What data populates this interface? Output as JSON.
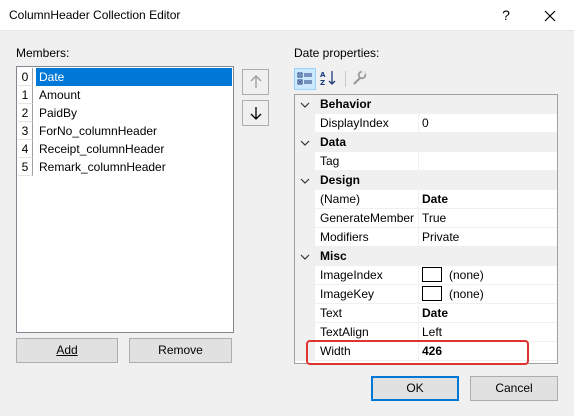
{
  "window": {
    "title": "ColumnHeader Collection Editor",
    "help_label": "?",
    "close_icon": "close-icon"
  },
  "members": {
    "label": "Members:",
    "items": [
      {
        "index": "0",
        "name": "Date",
        "selected": true
      },
      {
        "index": "1",
        "name": "Amount"
      },
      {
        "index": "2",
        "name": "PaidBy"
      },
      {
        "index": "3",
        "name": "ForNo_columnHeader"
      },
      {
        "index": "4",
        "name": "Receipt_columnHeader"
      },
      {
        "index": "5",
        "name": "Remark_columnHeader"
      }
    ],
    "move_up_icon": "arrow-up-icon",
    "move_down_icon": "arrow-down-icon"
  },
  "buttons": {
    "add": "Add",
    "remove": "Remove",
    "ok": "OK",
    "cancel": "Cancel"
  },
  "properties": {
    "label": "Date properties:",
    "toolbar": {
      "categorized_icon": "categorized-icon",
      "alphabetical_icon": "alphabetical-sort-icon",
      "property_pages_icon": "wrench-icon"
    },
    "categories": [
      {
        "name": "Behavior",
        "rows": [
          {
            "name": "DisplayIndex",
            "value": "0"
          }
        ]
      },
      {
        "name": "Data",
        "rows": [
          {
            "name": "Tag",
            "value": ""
          }
        ]
      },
      {
        "name": "Design",
        "rows": [
          {
            "name": "(Name)",
            "value": "Date",
            "bold": true
          },
          {
            "name": "GenerateMember",
            "value": "True"
          },
          {
            "name": "Modifiers",
            "value": "Private"
          }
        ]
      },
      {
        "name": "Misc",
        "rows": [
          {
            "name": "ImageIndex",
            "value": "(none)",
            "swatch": true
          },
          {
            "name": "ImageKey",
            "value": "(none)",
            "swatch": true
          },
          {
            "name": "Text",
            "value": "Date",
            "bold": true
          },
          {
            "name": "TextAlign",
            "value": "Left"
          },
          {
            "name": "Width",
            "value": "426",
            "bold": true,
            "highlighted": true
          }
        ]
      }
    ]
  },
  "colors": {
    "selection": "#0078d7",
    "highlight_box": "#e0322e",
    "dialog_bg": "#f0f0f0"
  }
}
